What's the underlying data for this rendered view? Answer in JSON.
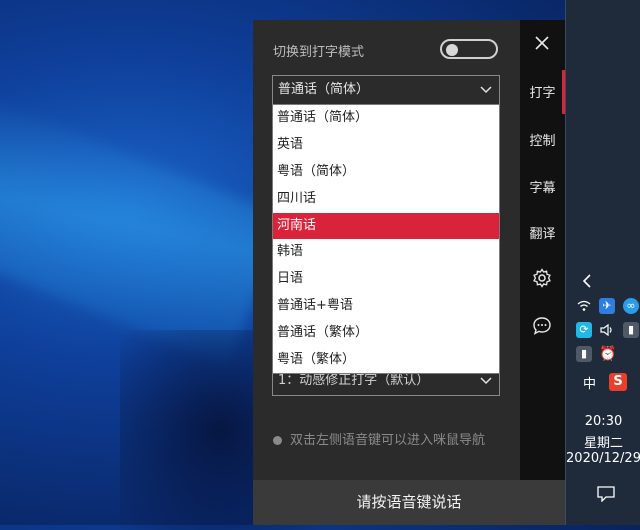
{
  "panel": {
    "mode_label": "切换到打字模式",
    "language_select": "普通话（简体）",
    "language_options": [
      "普通话（简体）",
      "英语",
      "粤语（简体）",
      "四川话",
      "河南话",
      "韩语",
      "日语",
      "普通话+粤语",
      "普通话（繁体）",
      "粤语（繁体）"
    ],
    "selected_option": "河南话",
    "typing_mode_select": "1：动感修正打字（默认）",
    "hint_text": "双击左侧语音键可以进入咪鼠导航",
    "talk_button": "请按语音键说话"
  },
  "nav": {
    "items": [
      "打字",
      "控制",
      "字幕",
      "翻译"
    ],
    "active": "打字",
    "icons": [
      "close-icon",
      "gear-icon",
      "feedback-icon"
    ]
  },
  "taskbar": {
    "ime_label": "中",
    "sogou_label": "S",
    "time": "20:30",
    "weekday": "星期二",
    "date": "2020/12/29"
  },
  "colors": {
    "accent": "#d9233b",
    "panel_bg": "#2b2b2b",
    "nav_bg": "#111111",
    "taskbar_bg": "#1f2a3a"
  }
}
